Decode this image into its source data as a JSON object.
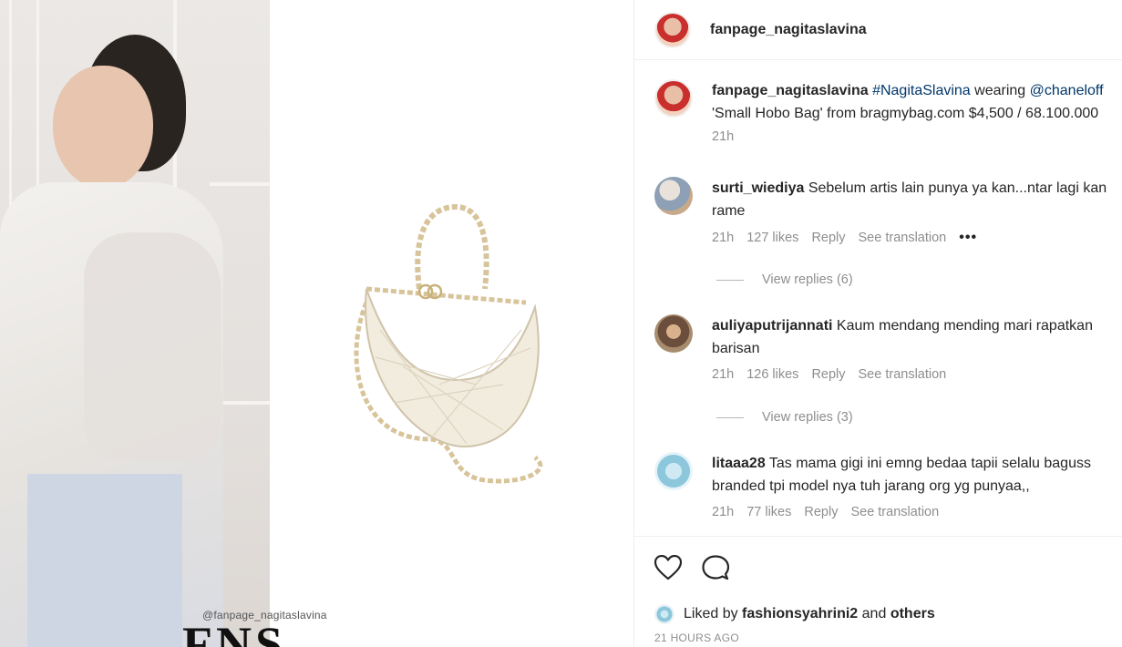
{
  "media": {
    "watermark": "@fanpage_nagitaslavina",
    "brand_logo": "FNS"
  },
  "post": {
    "author": "fanpage_nagitaslavina"
  },
  "caption": {
    "username": "fanpage_nagitaslavina",
    "hashtag": "#NagitaSlavina",
    "text_mid": " wearing ",
    "mention": "@chaneloff",
    "line2": "'Small Hobo Bag' from bragmybag.com $4,500 / 68.100.000",
    "time": "21h"
  },
  "comments": [
    {
      "username": "surti_wiediya",
      "line1": "Sebelum artis lain punya ya kan...ntar lagi kan",
      "line2": "rame",
      "time": "21h",
      "likes": "127 likes",
      "reply": "Reply",
      "translate": "See translation",
      "more": "•••",
      "view_replies": "View replies (6)"
    },
    {
      "username": "auliyaputrijannati",
      "line1": "Kaum mendang mending mari rapatkan",
      "line2": "barisan",
      "time": "21h",
      "likes": "126 likes",
      "reply": "Reply",
      "translate": "See translation",
      "view_replies": "View replies (3)"
    },
    {
      "username": "litaaa28",
      "line1": "Tas mama gigi ini emng bedaa tapii selalu baguss",
      "line2": "branded tpi model nya tuh jarang org yg punyaa,,",
      "time": "21h",
      "likes": "77 likes",
      "reply": "Reply",
      "translate": "See translation"
    }
  ],
  "footer": {
    "liked_by_prefix": "Liked by",
    "liked_by_user": "fashionsyahrini2",
    "liked_by_and": "and",
    "liked_by_others": "others",
    "time_ago": "21 HOURS AGO"
  },
  "icons": {
    "like": "heart-icon",
    "comment": "comment-bubble-icon",
    "more": "more-options-icon"
  },
  "colors": {
    "text": "#262626",
    "secondary": "#8e8e8e",
    "link": "#00376b",
    "border": "#efefef"
  }
}
